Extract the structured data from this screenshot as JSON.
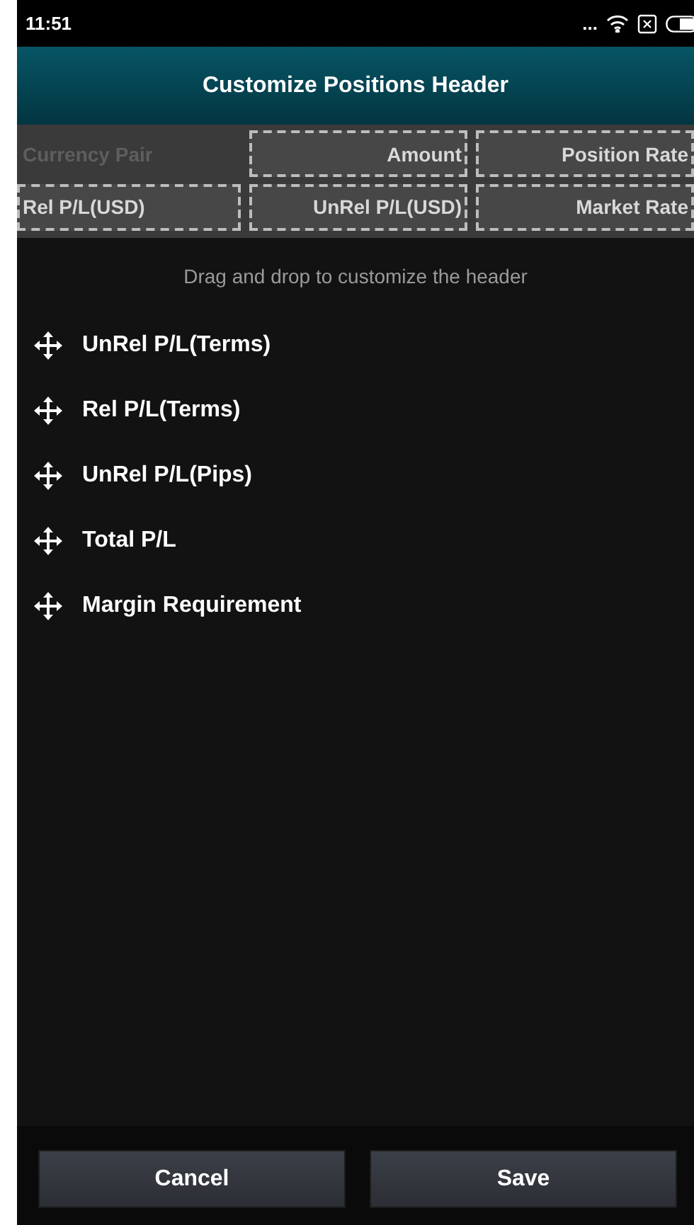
{
  "status_bar": {
    "time": "11:51",
    "dots": "..."
  },
  "title_bar": {
    "title": "Customize Positions Header"
  },
  "header_slots": [
    {
      "label": "Currency Pair",
      "disabled": true
    },
    {
      "label": "Amount",
      "disabled": false
    },
    {
      "label": "Position Rate",
      "disabled": false
    },
    {
      "label": "Rel P/L(USD)",
      "disabled": false
    },
    {
      "label": "UnRel P/L(USD)",
      "disabled": false
    },
    {
      "label": "Market Rate",
      "disabled": false
    }
  ],
  "instruction": "Drag and drop to customize the header",
  "available_columns": [
    "UnRel P/L(Terms)",
    "Rel P/L(Terms)",
    "UnRel P/L(Pips)",
    "Total P/L",
    "Margin Requirement"
  ],
  "buttons": [
    "Cancel",
    "Save"
  ]
}
